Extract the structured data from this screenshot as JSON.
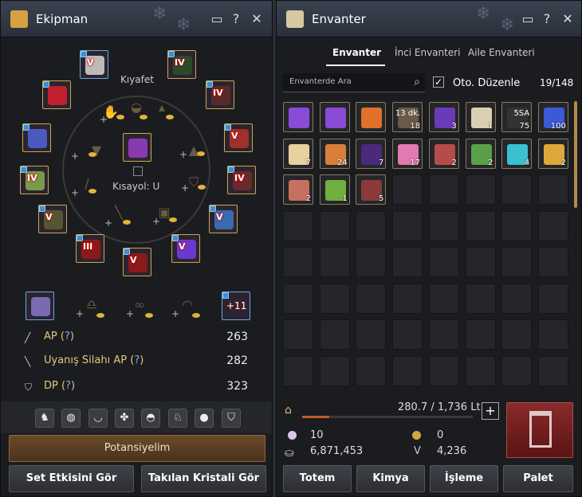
{
  "equipment": {
    "title": "Ekipman",
    "costume_label": "Kıyafet",
    "shortcut_label": "Kısayol: U",
    "gear_slots": [
      {
        "name": "helmet",
        "tier": "V",
        "gem": true
      },
      {
        "name": "armor",
        "tier": "IV",
        "gem": true
      },
      {
        "name": "necklace",
        "tier": "",
        "gem": true
      },
      {
        "name": "gloves-left",
        "tier": "IV",
        "gem": true
      },
      {
        "name": "ring-left",
        "tier": "",
        "gem": true
      },
      {
        "name": "ring-right",
        "tier": "V",
        "gem": true
      },
      {
        "name": "main-weapon",
        "tier": "IV",
        "gem": true
      },
      {
        "name": "shoes",
        "tier": "IV",
        "gem": true
      },
      {
        "name": "belt",
        "tier": "V",
        "gem": true
      },
      {
        "name": "earring",
        "tier": "V",
        "gem": true
      },
      {
        "name": "awakening-weapon",
        "tier": "III",
        "gem": true
      },
      {
        "name": "sub-weapon",
        "tier": "V",
        "gem": true
      },
      {
        "name": "pet-gloves",
        "tier": "V",
        "gem": true
      },
      {
        "name": "center-box",
        "tier": "",
        "gem": false
      }
    ],
    "artifact_label": "+11",
    "stats": [
      {
        "label": "AP",
        "value": "263",
        "icon": "sword-icon"
      },
      {
        "label": "Uyanış Silahı AP",
        "value": "282",
        "icon": "awakening-sword-icon"
      },
      {
        "label": "DP",
        "value": "323",
        "icon": "shield-icon"
      }
    ],
    "stat_help": "?",
    "tab_icons": [
      "horse-icon",
      "mask-icon",
      "mask2-icon",
      "paw-icon",
      "helmet-icon",
      "horse2-icon",
      "user-icon",
      "shield-icon"
    ],
    "potential_button": "Potansiyelim",
    "set_effect_button": "Set Etkisini Gör",
    "crystal_button": "Takılan Kristali Gör"
  },
  "inventory": {
    "title": "Envanter",
    "tabs": [
      "Envanter",
      "İnci Envanteri",
      "Aile Envanteri"
    ],
    "search_placeholder": "Envanterde Ara",
    "auto_sort_label": "Oto. Düzenle",
    "slot_count": "19/148",
    "items": [
      {
        "name": "purple-crystal",
        "count": "",
        "color": "#8a4bd8"
      },
      {
        "name": "purple-crystal-2",
        "count": "",
        "color": "#8a4bd8"
      },
      {
        "name": "hp-potion",
        "count": "",
        "color": "#e0702a"
      },
      {
        "name": "timed-item",
        "count": "18",
        "top": "13 dk.",
        "color": "#6a5a4a"
      },
      {
        "name": "mana-potion",
        "count": "3",
        "color": "#6a3ab8"
      },
      {
        "name": "scroll",
        "count": "1",
        "color": "#d8d0b0"
      },
      {
        "name": "timed-item-2",
        "count": "75",
        "top": "5SA",
        "color": "#333"
      },
      {
        "name": "blue-potion",
        "count": "100",
        "color": "#3a5ad8"
      },
      {
        "name": "elixir",
        "count": "7",
        "color": "#e8d0a0"
      },
      {
        "name": "meat",
        "count": "24",
        "color": "#d8803a"
      },
      {
        "name": "black-stone",
        "count": "7",
        "color": "#4a2a7a"
      },
      {
        "name": "pink-crystal",
        "count": "17",
        "color": "#e07ab0"
      },
      {
        "name": "red-shard",
        "count": "2",
        "color": "#b84a4a"
      },
      {
        "name": "green-shard",
        "count": "2",
        "color": "#5aa04a"
      },
      {
        "name": "cyan-orb",
        "count": "4",
        "color": "#3ac0d0"
      },
      {
        "name": "gold-ore",
        "count": "2",
        "color": "#e0a83a"
      },
      {
        "name": "copper-ore",
        "count": "2",
        "color": "#c87060"
      },
      {
        "name": "green-ore",
        "count": "1",
        "color": "#70b040"
      },
      {
        "name": "dagger",
        "count": "5",
        "color": "#8a3a3a"
      }
    ],
    "weight_text": "280.7 / 1,736 Lt",
    "weight_fraction": 0.16,
    "pearls": "10",
    "silver": "6,871,453",
    "loyalty": "0",
    "vp": "4,236",
    "buttons": [
      "Totem",
      "Kimya",
      "İşleme",
      "Palet"
    ]
  }
}
